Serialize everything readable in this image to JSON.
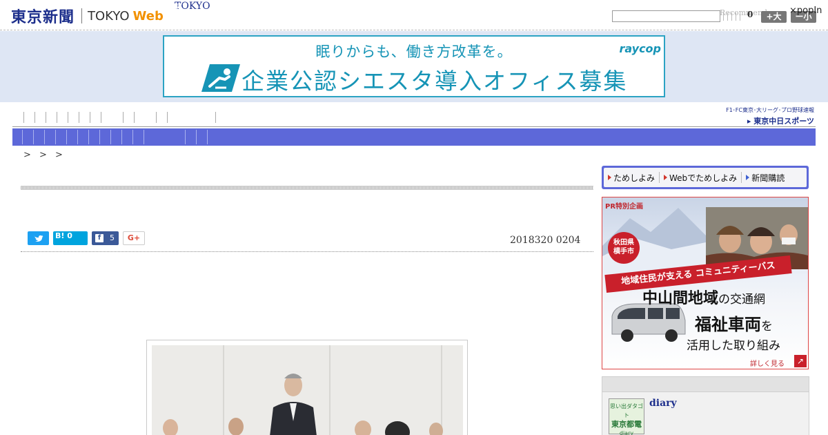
{
  "header": {
    "logo_jp": "東京新聞",
    "logo_en": "TOKYO",
    "logo_web": "Web",
    "search_placeholder": "",
    "recommend_label": "Recommend",
    "recommend_count": "0",
    "font_large": "+大",
    "font_small": "ー小",
    "popin": "⨯popIn"
  },
  "ad_banner": {
    "line1": "眠りからも、働き方改革を。",
    "brand": "raycop",
    "line2": "企業公認シエスタ導入オフィス募集"
  },
  "nav": {
    "row1_label": "TOKYO",
    "chunichi_small": "F1･FC東京･大リーグ･プロ野球速報",
    "chunichi_big": "▸ 東京中日スポーツ",
    "row2_label": "BOOK"
  },
  "breadcrumb": ">  >  >",
  "article": {
    "date": "2018320 0204",
    "share": {
      "twitter_icon": "twitter-icon",
      "hatena_label": "B! 0",
      "facebook_count": "5",
      "gplus_label": "G+"
    }
  },
  "sidebar": {
    "tameshi_items": [
      "ためしよみ",
      "Webでためしよみ",
      "新聞購読"
    ],
    "ad": {
      "pr_label": "PR特別企画",
      "badge": "秋田県\n横手市",
      "ribbon": "地域住民が支える コミュニティーバス",
      "line1_big": "中山間地域",
      "line1_small": "の交通網",
      "line2_big": "福祉車両",
      "line2_small": "を",
      "line3": "活用した取り組み",
      "more": "詳しく見る"
    },
    "diary": {
      "thumb_top": "思い出ダタゴト",
      "thumb_mid": "東京都電",
      "thumb_bottom": "diary",
      "title": "diary"
    }
  },
  "colors": {
    "nav_blue": "#5d68d9",
    "logo_navy": "#1d2f8c",
    "web_orange": "#f29100",
    "ad_cyan": "#1694b6",
    "ad_red": "#c9202b"
  }
}
